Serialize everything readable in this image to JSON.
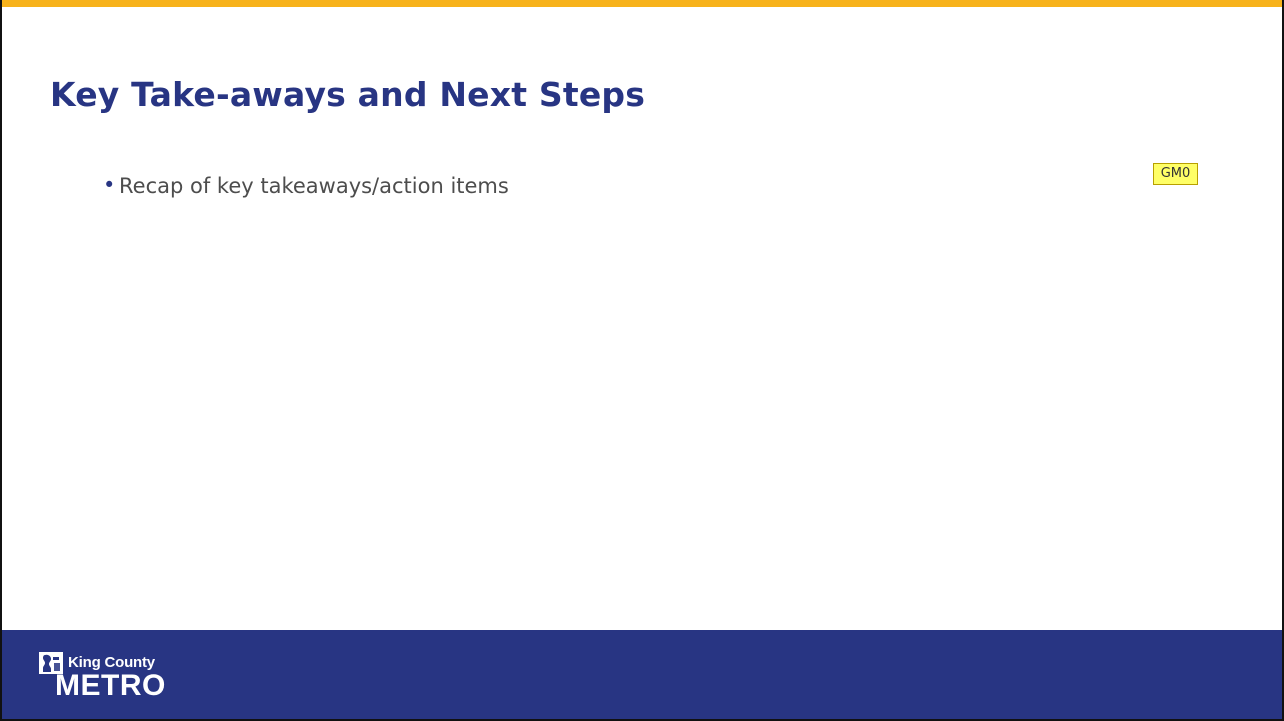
{
  "slide": {
    "title": "Key Take-aways and Next Steps",
    "bullets": [
      "Recap of key takeaways/action items"
    ],
    "comment_marker": "GM0"
  },
  "footer": {
    "logo": {
      "county_text": "King County",
      "metro_text": "METRO"
    }
  },
  "colors": {
    "accent_bar": "#f7b21b",
    "title": "#283583",
    "footer": "#283583",
    "body_text": "#4d4d4d",
    "comment_marker": "#ffff66"
  },
  "icons": {
    "logo_mark": "king-county-logo-icon",
    "bullet": "bullet-dot-icon"
  }
}
